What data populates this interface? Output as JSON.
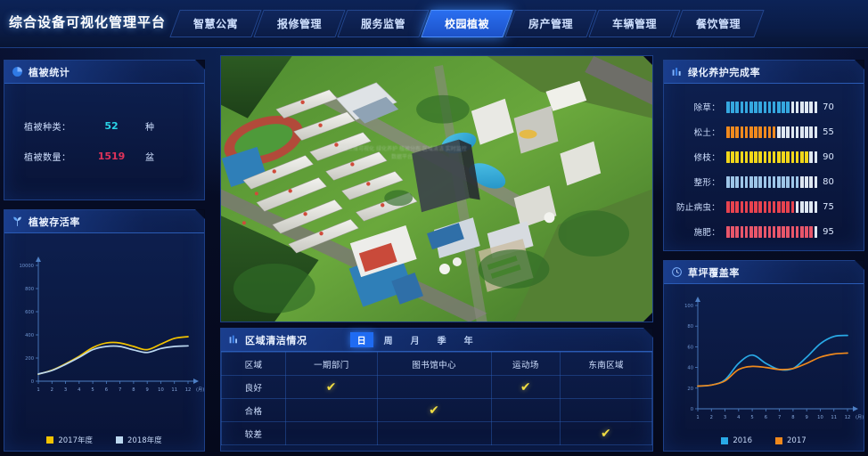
{
  "header": {
    "brand": "综合设备可视化管理平台",
    "tabs": [
      {
        "label": "智慧公寓",
        "active": false
      },
      {
        "label": "报修管理",
        "active": false
      },
      {
        "label": "服务监管",
        "active": false
      },
      {
        "label": "校园植被",
        "active": true
      },
      {
        "label": "房产管理",
        "active": false
      },
      {
        "label": "车辆管理",
        "active": false
      },
      {
        "label": "餐饮管理",
        "active": false
      }
    ]
  },
  "stats_panel": {
    "title": "植被统计",
    "icon": "pie-chart-icon",
    "rows": [
      {
        "label": "植被种类：",
        "value": "52",
        "unit": "种",
        "color": "#2ad4e8"
      },
      {
        "label": "植被数量：",
        "value": "1519",
        "unit": "盆",
        "color": "#e0335a"
      }
    ]
  },
  "survival_panel": {
    "title": "植被存活率",
    "icon": "plant-icon"
  },
  "maintenance_panel": {
    "title": "绿化养护完成率",
    "icon": "bar-chart-icon",
    "segments_total": 20,
    "rows": [
      {
        "label": "除草：",
        "value": 70,
        "color": "#35a8e0"
      },
      {
        "label": "松土：",
        "value": 55,
        "color": "#f08a1e"
      },
      {
        "label": "修枝：",
        "value": 90,
        "color": "#f2d71a"
      },
      {
        "label": "整形：",
        "value": 80,
        "color": "#9ec6e8"
      },
      {
        "label": "防止病虫：",
        "value": 75,
        "color": "#e8434f"
      },
      {
        "label": "施肥：",
        "value": 95,
        "color": "#e8566a"
      }
    ],
    "empty_color": "#dfe8f2"
  },
  "lawn_panel": {
    "title": "草坪覆盖率",
    "icon": "clock-icon"
  },
  "clean_panel": {
    "title": "区域清洁情况",
    "icon": "bars-icon",
    "period_tabs": [
      {
        "label": "日",
        "active": true
      },
      {
        "label": "周",
        "active": false
      },
      {
        "label": "月",
        "active": false
      },
      {
        "label": "季",
        "active": false
      },
      {
        "label": "年",
        "active": false
      }
    ],
    "columns": [
      "区域",
      "一期部门",
      "图书馆中心",
      "运动场",
      "东南区域"
    ],
    "rows": [
      {
        "label": "良好",
        "marks": [
          true,
          false,
          true,
          false
        ]
      },
      {
        "label": "合格",
        "marks": [
          false,
          true,
          false,
          false
        ]
      },
      {
        "label": "较差",
        "marks": [
          false,
          false,
          false,
          true
        ]
      }
    ],
    "check_glyph": "✔"
  },
  "center_map": {
    "name": "campus-aerial-view",
    "watermark": "校园三维可视化 绿化养护 植被分布 区域清洁 实时监控 数据平台"
  },
  "chart_data": [
    {
      "id": "survival",
      "type": "line",
      "title": "植被存活率",
      "xlabel": "(月)",
      "ylabel": "",
      "categories": [
        1,
        2,
        3,
        4,
        5,
        6,
        7,
        8,
        9,
        10,
        11,
        12
      ],
      "ytick_labels": [
        "10000",
        "800",
        "600",
        "400",
        "200",
        "0"
      ],
      "ylim": [
        0,
        1000
      ],
      "grid": false,
      "legend_position": "bottom",
      "series": [
        {
          "name": "2017年度",
          "color": "#f2c300",
          "values": [
            60,
            95,
            150,
            215,
            290,
            330,
            330,
            300,
            272,
            320,
            370,
            385
          ]
        },
        {
          "name": "2018年度",
          "color": "#bcd8f0",
          "values": [
            62,
            92,
            145,
            205,
            272,
            300,
            300,
            270,
            248,
            282,
            300,
            305
          ]
        }
      ]
    },
    {
      "id": "lawn",
      "type": "line",
      "title": "草坪覆盖率",
      "xlabel": "(月)",
      "ylabel": "",
      "categories": [
        1,
        2,
        3,
        4,
        5,
        6,
        7,
        8,
        9,
        10,
        11,
        12
      ],
      "ytick_labels": [
        "100",
        "80",
        "60",
        "40",
        "20",
        "0"
      ],
      "ylim": [
        0,
        100
      ],
      "grid": false,
      "legend_position": "bottom",
      "series": [
        {
          "name": "2016",
          "color": "#29a9e6",
          "values": [
            22,
            23,
            28,
            44,
            52,
            44,
            38,
            39,
            50,
            63,
            70,
            71
          ]
        },
        {
          "name": "2017",
          "color": "#f0891c",
          "values": [
            22,
            23,
            27,
            38,
            41,
            40,
            38,
            39,
            44,
            50,
            53,
            54
          ]
        }
      ]
    }
  ]
}
